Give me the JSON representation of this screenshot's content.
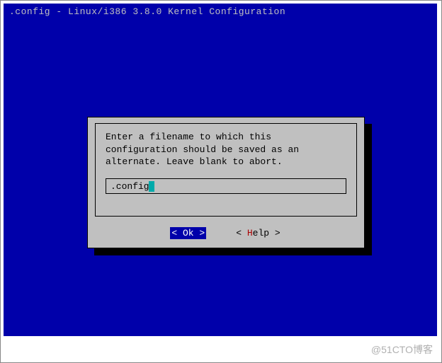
{
  "title": ".config - Linux/i386 3.8.0 Kernel Configuration",
  "dialog": {
    "prompt": "Enter a filename to which this configuration should be saved as an alternate.  Leave blank to abort.",
    "input_value": ".config"
  },
  "buttons": {
    "ok": {
      "bracket_open": "<",
      "spacer1": " ",
      "hotkey": "O",
      "rest": "k",
      "spacer2": " ",
      "bracket_close": ">"
    },
    "help": {
      "bracket_open": "<",
      "spacer1": " ",
      "hotkey": "H",
      "rest": "elp",
      "spacer2": " ",
      "bracket_close": ">"
    }
  },
  "watermark": "@51CTO博客"
}
